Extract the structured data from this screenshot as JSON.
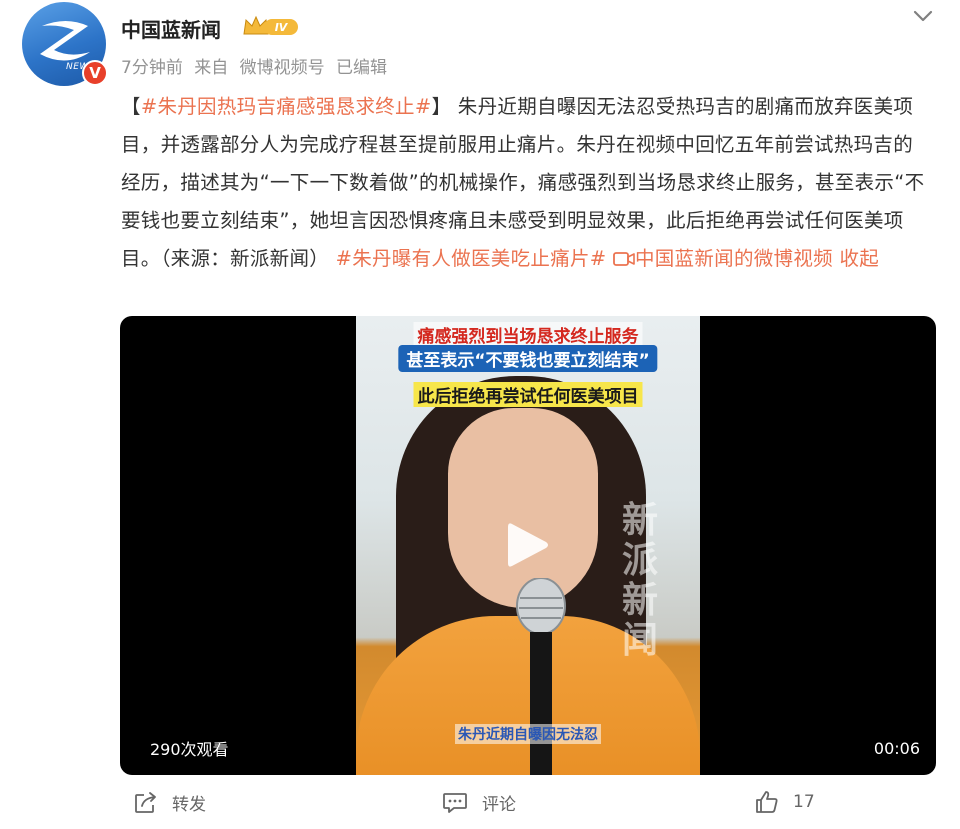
{
  "author": {
    "name": "中国蓝新闻",
    "avatar_text": "NEWS",
    "verified_badge": "V",
    "level_badge": "IV"
  },
  "meta": {
    "time": "7分钟前",
    "source_prefix": "来自",
    "source": "微博视频号",
    "edited": "已编辑"
  },
  "post": {
    "title_open": "【",
    "title_tag": "#朱丹因热玛吉痛感强恳求终止#",
    "title_close": "】",
    "body": " 朱丹近期自曝因无法忍受热玛吉的剧痛而放弃医美项目，并透露部分人为完成疗程甚至提前服用止痛片。朱丹在视频中回忆五年前尝试热玛吉的经历，描述其为“一下一下数着做”的机械操作，痛感强烈到当场恳求终止服务，甚至表示“不要钱也要立刻结束”，她坦言因恐惧疼痛且未感受到明显效果，此后拒绝再尝试任何医美项目。（来源：新派新闻） ",
    "tag2": "#朱丹曝有人做医美吃止痛片#",
    "video_link": "中国蓝新闻的微博视频",
    "collapse": "收起"
  },
  "video": {
    "caption1": "痛感强烈到当场恳求终止服务",
    "caption2": "甚至表示“不要钱也要立刻结束”",
    "caption3": "此后拒绝再尝试任何医美项目",
    "subtitle": "朱丹近期自曝因无法忍",
    "watermark": "新派新闻",
    "views": "290次观看",
    "duration": "00:06"
  },
  "actions": {
    "repost": "转发",
    "comment": "评论",
    "like_count": "17"
  },
  "colors": {
    "link": "#eb7350",
    "meta": "#939393",
    "verified": "#e8402a"
  }
}
